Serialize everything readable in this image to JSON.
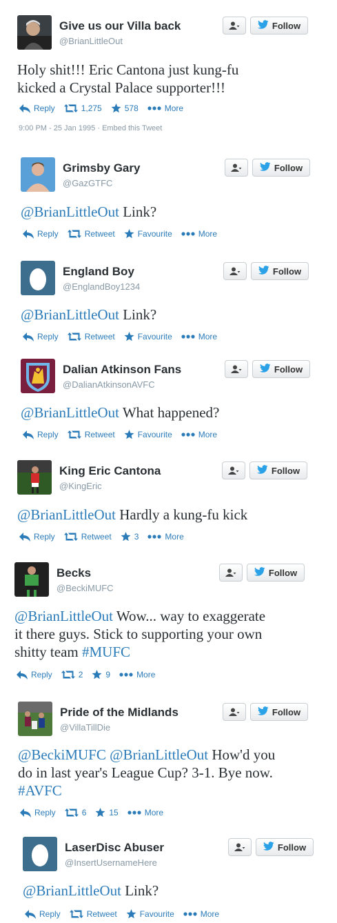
{
  "buttons": {
    "follow": "Follow"
  },
  "colors": {
    "link": "#2b7bb9",
    "name": "#292f33",
    "muted": "#8899a6"
  },
  "tweets": [
    {
      "name": "Give us our Villa back",
      "handle": "@BrianLittleOut",
      "avatar_icon": "man-photo-avatar",
      "lines": [
        [
          {
            "t": "Holy shit!!! Eric Cantona just kung-fu",
            "k": "text"
          }
        ],
        [
          {
            "t": "kicked a Crystal Palace supporter!!!",
            "k": "text"
          }
        ]
      ],
      "actions": {
        "reply": "Reply",
        "retweet": "1,275",
        "favourite": "578",
        "more": "More"
      },
      "timestamp": "9:00 PM - 25 Jan 1995",
      "embed": "Embed this Tweet"
    },
    {
      "name": "Grimsby Gary",
      "handle": "@GazGTFC",
      "avatar_icon": "shirtless-man-avatar",
      "lines": [
        [
          {
            "t": "@BrianLittleOut",
            "k": "mention"
          },
          {
            "t": " Link?",
            "k": "text"
          }
        ]
      ],
      "actions": {
        "reply": "Reply",
        "retweet": "Retweet",
        "favourite": "Favourite",
        "more": "More"
      }
    },
    {
      "name": "England Boy",
      "handle": "@EnglandBoy1234",
      "avatar_icon": "egg-avatar",
      "lines": [
        [
          {
            "t": "@BrianLittleOut",
            "k": "mention"
          },
          {
            "t": " Link?",
            "k": "text"
          }
        ]
      ],
      "actions": {
        "reply": "Reply",
        "retweet": "Retweet",
        "favourite": "Favourite",
        "more": "More"
      }
    },
    {
      "name": "Dalian Atkinson Fans",
      "handle": "@DalianAtkinsonAVFC",
      "avatar_icon": "aston-villa-crest-avatar",
      "lines": [
        [
          {
            "t": "@BrianLittleOut",
            "k": "mention"
          },
          {
            "t": " What happened?",
            "k": "text"
          }
        ]
      ],
      "actions": {
        "reply": "Reply",
        "retweet": "Retweet",
        "favourite": "Favourite",
        "more": "More"
      }
    },
    {
      "name": "King Eric Cantona",
      "handle": "@KingEric",
      "avatar_icon": "footballer-red-kit-avatar",
      "lines": [
        [
          {
            "t": "@BrianLittleOut",
            "k": "mention"
          },
          {
            "t": " Hardly a kung-fu kick",
            "k": "text"
          }
        ]
      ],
      "actions": {
        "reply": "Reply",
        "retweet": "Retweet",
        "favourite": "3",
        "more": "More"
      }
    },
    {
      "name": "Becks",
      "handle": "@BeckiMUFC",
      "avatar_icon": "goalkeeper-green-kit-avatar",
      "lines": [
        [
          {
            "t": "@BrianLittleOut",
            "k": "mention"
          },
          {
            "t": " Wow... way to exaggerate",
            "k": "text"
          }
        ],
        [
          {
            "t": "it there guys. Stick to supporting your own",
            "k": "text"
          }
        ],
        [
          {
            "t": "shitty team ",
            "k": "text"
          },
          {
            "t": "#MUFC",
            "k": "hashtag"
          }
        ]
      ],
      "actions": {
        "reply": "Reply",
        "retweet": "2",
        "favourite": "9",
        "more": "More"
      }
    },
    {
      "name": "Pride of the Midlands",
      "handle": "@VillaTillDie",
      "avatar_icon": "football-match-avatar",
      "lines": [
        [
          {
            "t": "@BeckiMUFC",
            "k": "mention"
          },
          {
            "t": " ",
            "k": "text"
          },
          {
            "t": "@BrianLittleOut",
            "k": "mention"
          },
          {
            "t": " How'd you",
            "k": "text"
          }
        ],
        [
          {
            "t": "do in last year's League Cup? 3-1. Bye now.",
            "k": "text"
          }
        ],
        [
          {
            "t": "#AVFC",
            "k": "hashtag"
          }
        ]
      ],
      "actions": {
        "reply": "Reply",
        "retweet": "6",
        "favourite": "15",
        "more": "More"
      }
    },
    {
      "name": "LaserDisc Abuser",
      "handle": "@InsertUsernameHere",
      "avatar_icon": "egg-avatar",
      "lines": [
        [
          {
            "t": "@BrianLittleOut",
            "k": "mention"
          },
          {
            "t": " Link?",
            "k": "text"
          }
        ]
      ],
      "actions": {
        "reply": "Reply",
        "retweet": "Retweet",
        "favourite": "Favourite",
        "more": "More"
      }
    }
  ]
}
